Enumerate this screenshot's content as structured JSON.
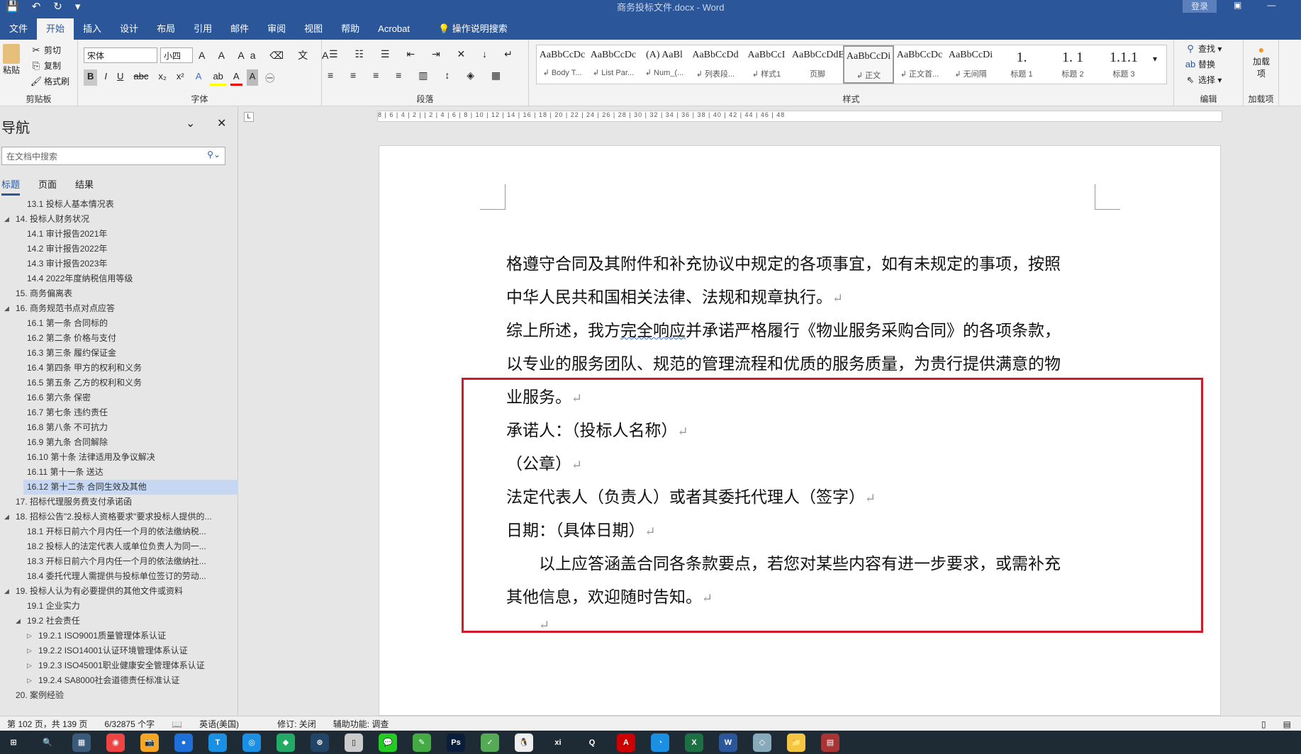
{
  "window": {
    "title": "商务投标文件.docx - Word",
    "login": "登录"
  },
  "qat": {
    "save": "💾",
    "undo": "↶",
    "redo": "↻",
    "more": "▾"
  },
  "tabs": [
    "文件",
    "开始",
    "插入",
    "设计",
    "布局",
    "引用",
    "邮件",
    "审阅",
    "视图",
    "帮助",
    "Acrobat"
  ],
  "tell_me": "操作说明搜索",
  "ribbon": {
    "clipboard": {
      "paste": "粘贴",
      "cut": "剪切",
      "copy": "复制",
      "format_painter": "格式刷",
      "label": "剪贴板"
    },
    "font": {
      "name": "宋体",
      "size": "小四",
      "label": "字体",
      "bold": "B",
      "italic": "I",
      "underline": "U",
      "strike": "abc",
      "sub": "x₂",
      "sup": "x²"
    },
    "paragraph": {
      "label": "段落"
    },
    "styles": {
      "label": "样式",
      "items": [
        {
          "preview": "AaBbCcDc",
          "name": "↲ Body T..."
        },
        {
          "preview": "AaBbCcDc",
          "name": "↲ List Par..."
        },
        {
          "preview": "(A) AaBl",
          "name": "↲ Num_(..."
        },
        {
          "preview": "AaBbCcDd",
          "name": "↲ 列表段..."
        },
        {
          "preview": "AaBbCcI",
          "name": "↲ 样式1"
        },
        {
          "preview": "AaBbCcDdE",
          "name": "页脚"
        },
        {
          "preview": "AaBbCcDi",
          "name": "↲ 正文"
        },
        {
          "preview": "AaBbCcDc",
          "name": "↲ 正文首..."
        },
        {
          "preview": "AaBbCcDi",
          "name": "↲ 无间隔"
        },
        {
          "preview": "1.",
          "name": "标题 1"
        },
        {
          "preview": "1. 1",
          "name": "标题 2"
        },
        {
          "preview": "1.1.1",
          "name": "标题 3"
        }
      ]
    },
    "editing": {
      "find": "查找",
      "replace": "替换",
      "select": "选择",
      "label": "编辑"
    },
    "addins": {
      "button": "加载项",
      "label": "加载项"
    }
  },
  "nav": {
    "title": "导航",
    "search_placeholder": "在文档中搜索",
    "tabs": [
      "标题",
      "页面",
      "结果"
    ],
    "items": [
      {
        "text": "13.1 投标人基本情况表",
        "level": 2,
        "toggle": ""
      },
      {
        "text": "14. 投标人财务状况",
        "level": 1,
        "toggle": "◢"
      },
      {
        "text": "14.1 审计报告2021年",
        "level": 2,
        "toggle": ""
      },
      {
        "text": "14.2 审计报告2022年",
        "level": 2,
        "toggle": ""
      },
      {
        "text": "14.3 审计报告2023年",
        "level": 2,
        "toggle": ""
      },
      {
        "text": "14.4 2022年度纳税信用等级",
        "level": 2,
        "toggle": ""
      },
      {
        "text": "15. 商务偏离表",
        "level": 1,
        "toggle": ""
      },
      {
        "text": "16. 商务规范书点对点应答",
        "level": 1,
        "toggle": "◢"
      },
      {
        "text": "16.1 第一条 合同标的",
        "level": 2,
        "toggle": ""
      },
      {
        "text": "16.2 第二条 价格与支付",
        "level": 2,
        "toggle": ""
      },
      {
        "text": "16.3 第三条 履约保证金",
        "level": 2,
        "toggle": ""
      },
      {
        "text": "16.4 第四条 甲方的权利和义务",
        "level": 2,
        "toggle": ""
      },
      {
        "text": "16.5 第五条 乙方的权利和义务",
        "level": 2,
        "toggle": ""
      },
      {
        "text": "16.6 第六条 保密",
        "level": 2,
        "toggle": ""
      },
      {
        "text": "16.7 第七条 违约责任",
        "level": 2,
        "toggle": ""
      },
      {
        "text": "16.8 第八条 不可抗力",
        "level": 2,
        "toggle": ""
      },
      {
        "text": "16.9 第九条 合同解除",
        "level": 2,
        "toggle": ""
      },
      {
        "text": "16.10 第十条 法律适用及争议解决",
        "level": 2,
        "toggle": ""
      },
      {
        "text": "16.11 第十一条 送达",
        "level": 2,
        "toggle": ""
      },
      {
        "text": "16.12 第十二条 合同生效及其他",
        "level": 2,
        "toggle": "",
        "selected": true
      },
      {
        "text": "17. 招标代理服务费支付承诺函",
        "level": 1,
        "toggle": ""
      },
      {
        "text": "18. 招标公告\"2.投标人资格要求\"要求投标人提供的...",
        "level": 1,
        "toggle": "◢"
      },
      {
        "text": "18.1 开标日前六个月内任一个月的依法缴纳税...",
        "level": 2,
        "toggle": ""
      },
      {
        "text": "18.2 投标人的法定代表人或单位负责人为同一...",
        "level": 2,
        "toggle": ""
      },
      {
        "text": "18.3 开标日前六个月内任一个月的依法缴纳社...",
        "level": 2,
        "toggle": ""
      },
      {
        "text": "18.4 委托代理人需提供与投标单位签订的劳动...",
        "level": 2,
        "toggle": ""
      },
      {
        "text": "19. 投标人认为有必要提供的其他文件或资料",
        "level": 1,
        "toggle": "◢"
      },
      {
        "text": "19.1 企业实力",
        "level": 2,
        "toggle": ""
      },
      {
        "text": "19.2 社会责任",
        "level": 2,
        "toggle": "◢"
      },
      {
        "text": "19.2.1 ISO9001质量管理体系认证",
        "level": 3,
        "toggle": "▷"
      },
      {
        "text": "19.2.2 ISO14001认证环境管理体系认证",
        "level": 3,
        "toggle": "▷"
      },
      {
        "text": "19.2.3 ISO45001职业健康安全管理体系认证",
        "level": 3,
        "toggle": "▷"
      },
      {
        "text": "19.2.4 SA8000社会道德责任标准认证",
        "level": 3,
        "toggle": "▷"
      },
      {
        "text": "20. 案例经验",
        "level": 1,
        "toggle": ""
      }
    ]
  },
  "ruler": "8 | 6 | 4 | 2 |  | 2 | 4 | 6 | 8 | 10 | 12 | 14 | 16 | 18 | 20 | 22 | 24 | 26 | 28 | 30 | 32 | 34 | 36 | 38 | 40 | 42 | 44 | 46 | 48",
  "document": {
    "lines": [
      {
        "text": "格遵守合同及其附件和补充协议中规定的各项事宜，如有未规定的事项，按照",
        "mark": ""
      },
      {
        "text": "中华人民共和国相关法律、法规和规章执行。",
        "mark": "↵"
      },
      {
        "pre": "综上所述，我方",
        "squiggle": "完全响应",
        "text": "并承诺严格履行《物业服务采购合同》的各项条款，",
        "mark": ""
      },
      {
        "text": "以专业的服务团队、规范的管理流程和优质的服务质量，为贵行提供满意的物",
        "mark": ""
      },
      {
        "text": "业服务。",
        "mark": "↵"
      },
      {
        "text": "承诺人：（投标人名称）",
        "mark": "↵"
      },
      {
        "text": "（公章）",
        "mark": "↵"
      },
      {
        "text": "法定代表人（负责人）或者其委托代理人（签字）",
        "mark": "↵"
      },
      {
        "text": "日期：（具体日期）",
        "mark": "↵"
      },
      {
        "text": "　　以上应答涵盖合同各条款要点，若您对某些内容有进一步要求，或需补充",
        "mark": ""
      },
      {
        "text": "其他信息，欢迎随时告知。",
        "mark": "↵"
      },
      {
        "text": "　　",
        "mark": "↵"
      }
    ]
  },
  "status": {
    "page": "第 102 页，共 139 页",
    "words": "6/32875 个字",
    "language": "英语(美国)",
    "track": "修订: 关闭",
    "accessibility": "辅助功能: 调查"
  },
  "taskbar": [
    "⊞",
    "🔍",
    "▦",
    "◉",
    "📷",
    "●",
    "T",
    "◎",
    "◆",
    "⊛",
    "▯",
    "💬",
    "✎",
    "Ps",
    "✓",
    "🐧",
    "xi",
    "Q",
    "A",
    "◔",
    "X",
    "W",
    "◇",
    "📁",
    "▤"
  ]
}
